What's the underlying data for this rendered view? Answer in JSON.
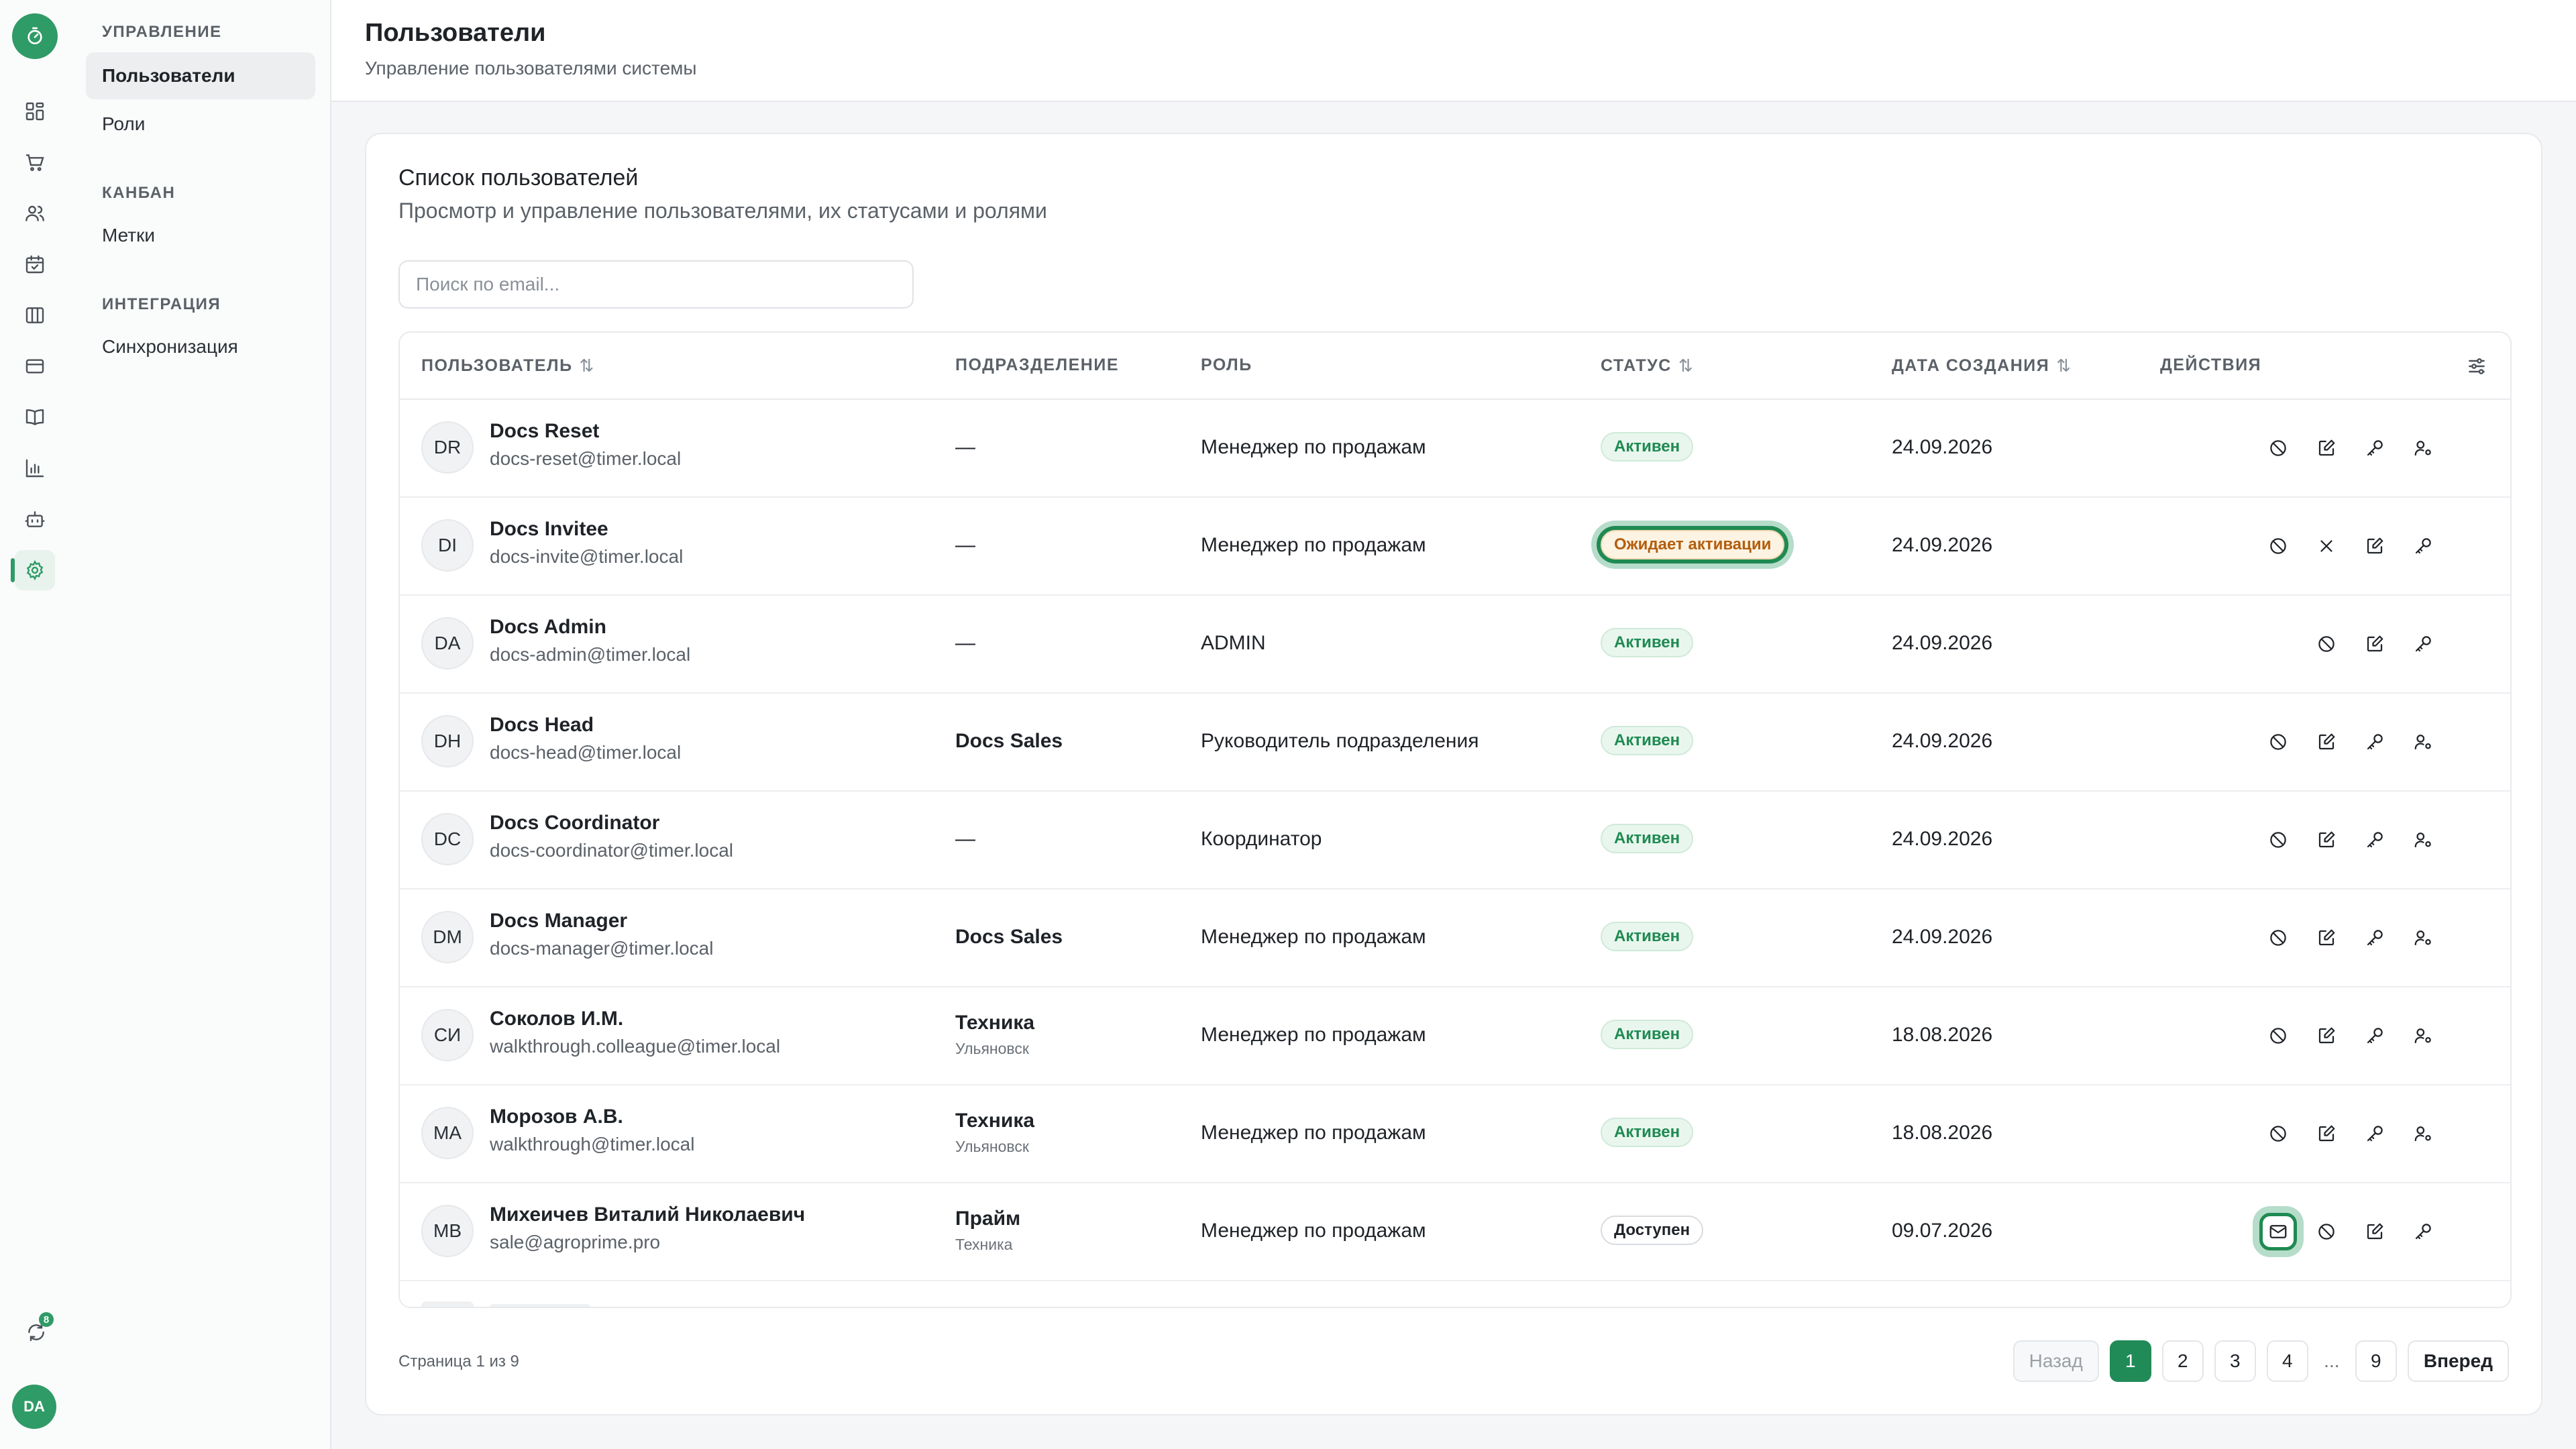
{
  "sidebar": {
    "groups": [
      {
        "label": "УПРАВЛЕНИЕ",
        "items": [
          "Пользователи",
          "Роли"
        ]
      },
      {
        "label": "КАНБАН",
        "items": [
          "Метки"
        ]
      },
      {
        "label": "ИНТЕГРАЦИЯ",
        "items": [
          "Синхронизация"
        ]
      }
    ]
  },
  "rail": {
    "icons": [
      "logo-timer-icon",
      "dashboard-icon",
      "cart-icon",
      "users-icon",
      "calendar-icon",
      "columns-icon",
      "card-icon",
      "book-icon",
      "chart-icon",
      "bot-icon",
      "gear-icon"
    ],
    "sync_badge": "8",
    "avatar": "DA"
  },
  "header": {
    "title": "Пользователи",
    "subtitle": "Управление пользователями системы"
  },
  "card": {
    "title": "Список пользователей",
    "subtitle": "Просмотр и управление пользователями, их статусами и ролями",
    "search_placeholder": "Поиск по email..."
  },
  "columns": {
    "user": "ПОЛЬЗОВАТЕЛЬ",
    "dept": "ПОДРАЗДЕЛЕНИЕ",
    "role": "РОЛЬ",
    "status": "СТАТУС",
    "created": "ДАТА СОЗДАНИЯ",
    "actions": "ДЕЙСТВИЯ",
    "sort_glyph": "⇅"
  },
  "rows": [
    {
      "initials": "DR",
      "name": "Docs Reset",
      "email": "docs-reset@timer.local",
      "dept": "—",
      "dept2": "",
      "role": "Менеджер по продажам",
      "status": "Активен",
      "status_kind": "active",
      "date": "24.09.2026",
      "actions": [
        "",
        "block-icon",
        "edit-icon",
        "key-icon",
        "user-settings-icon"
      ]
    },
    {
      "initials": "DI",
      "name": "Docs Invitee",
      "email": "docs-invite@timer.local",
      "dept": "—",
      "dept2": "",
      "role": "Менеджер по продажам",
      "status": "Ожидает активации",
      "status_kind": "pending",
      "date": "24.09.2026",
      "actions": [
        "",
        "block-icon",
        "close-icon",
        "edit-icon",
        "key-icon"
      ]
    },
    {
      "initials": "DA",
      "name": "Docs Admin",
      "email": "docs-admin@timer.local",
      "dept": "—",
      "dept2": "",
      "role": "ADMIN",
      "status": "Активен",
      "status_kind": "active",
      "date": "24.09.2026",
      "actions": [
        "",
        "",
        "block-icon",
        "edit-icon",
        "key-icon"
      ]
    },
    {
      "initials": "DH",
      "name": "Docs Head",
      "email": "docs-head@timer.local",
      "dept": "Docs Sales",
      "dept2": "",
      "role": "Руководитель подразделения",
      "status": "Активен",
      "status_kind": "active",
      "date": "24.09.2026",
      "actions": [
        "",
        "block-icon",
        "edit-icon",
        "key-icon",
        "user-settings-icon"
      ]
    },
    {
      "initials": "DC",
      "name": "Docs Coordinator",
      "email": "docs-coordinator@timer.local",
      "dept": "—",
      "dept2": "",
      "role": "Координатор",
      "status": "Активен",
      "status_kind": "active",
      "date": "24.09.2026",
      "actions": [
        "",
        "block-icon",
        "edit-icon",
        "key-icon",
        "user-settings-icon"
      ]
    },
    {
      "initials": "DM",
      "name": "Docs Manager",
      "email": "docs-manager@timer.local",
      "dept": "Docs Sales",
      "dept2": "",
      "role": "Менеджер по продажам",
      "status": "Активен",
      "status_kind": "active",
      "date": "24.09.2026",
      "actions": [
        "",
        "block-icon",
        "edit-icon",
        "key-icon",
        "user-settings-icon"
      ]
    },
    {
      "initials": "СИ",
      "name": "Соколов И.М.",
      "email": "walkthrough.colleague@timer.local",
      "dept": "Техника",
      "dept2": "Ульяновск",
      "role": "Менеджер по продажам",
      "status": "Активен",
      "status_kind": "active",
      "date": "18.08.2026",
      "actions": [
        "",
        "block-icon",
        "edit-icon",
        "key-icon",
        "user-settings-icon"
      ]
    },
    {
      "initials": "МА",
      "name": "Морозов А.В.",
      "email": "walkthrough@timer.local",
      "dept": "Техника",
      "dept2": "Ульяновск",
      "role": "Менеджер по продажам",
      "status": "Активен",
      "status_kind": "active",
      "date": "18.08.2026",
      "actions": [
        "",
        "block-icon",
        "edit-icon",
        "key-icon",
        "user-settings-icon"
      ]
    },
    {
      "initials": "МВ",
      "name": "Михеичев Виталий Николаевич",
      "email": "sale@agroprime.pro",
      "dept": "Прайм",
      "dept2": "Техника",
      "role": "Менеджер по продажам",
      "status": "Доступен",
      "status_kind": "free",
      "date": "09.07.2026",
      "actions": [
        "",
        "mail-icon",
        "block-icon",
        "edit-icon",
        "key-icon"
      ]
    }
  ],
  "highlights": {
    "status_row": 1,
    "action_row": 8,
    "action_icon": "mail-icon"
  },
  "pagination": {
    "info": "Страница 1 из 9",
    "prev": "Назад",
    "pages": [
      "1",
      "2",
      "3",
      "4"
    ],
    "ellipsis": "...",
    "last": "9",
    "next": "Вперед",
    "current": "1"
  },
  "colors": {
    "accent": "#2f9b66",
    "active_badge": "#1f8a52",
    "pending_badge": "#b25e0e"
  }
}
